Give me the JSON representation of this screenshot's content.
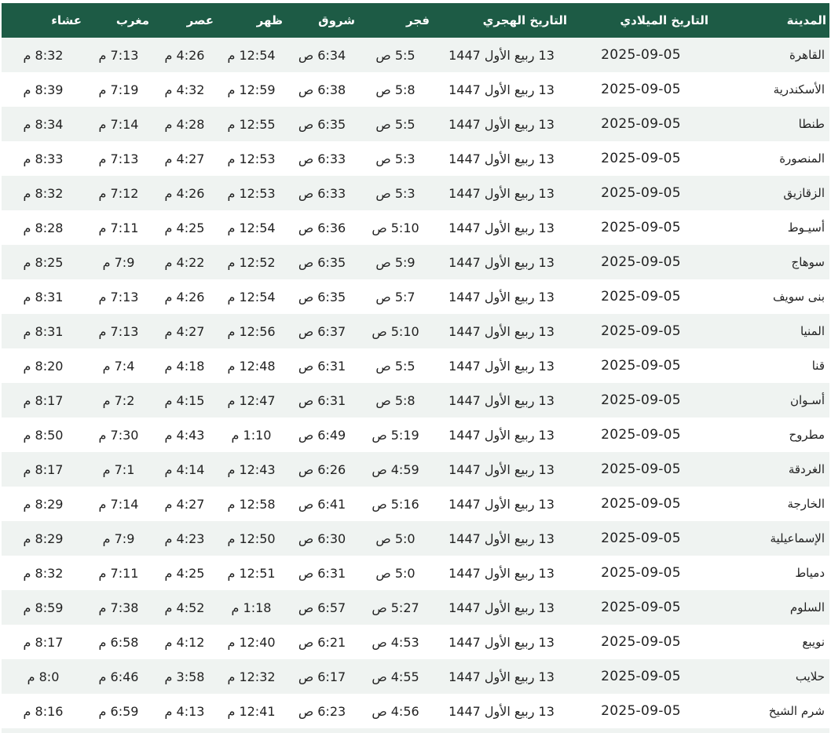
{
  "headers": [
    "المدينة",
    "التاريخ الميلادي",
    "التاريخ الهجري",
    "فجر",
    "شروق",
    "ظهر",
    "عصر",
    "مغرب",
    "عشاء"
  ],
  "rows": [
    [
      "القاهرة",
      "2025-09-05",
      "13 ربيع الأول 1447",
      "5:5 ص",
      "6:34 ص",
      "12:54 م",
      "4:26 م",
      "7:13 م",
      "8:32 م"
    ],
    [
      "الأسكندرية",
      "2025-09-05",
      "13 ربيع الأول 1447",
      "5:8 ص",
      "6:38 ص",
      "12:59 م",
      "4:32 م",
      "7:19 م",
      "8:39 م"
    ],
    [
      "طنطا",
      "2025-09-05",
      "13 ربيع الأول 1447",
      "5:5 ص",
      "6:35 ص",
      "12:55 م",
      "4:28 م",
      "7:14 م",
      "8:34 م"
    ],
    [
      "المنصورة",
      "2025-09-05",
      "13 ربيع الأول 1447",
      "5:3 ص",
      "6:33 ص",
      "12:53 م",
      "4:27 م",
      "7:13 م",
      "8:33 م"
    ],
    [
      "الزقازيق",
      "2025-09-05",
      "13 ربيع الأول 1447",
      "5:3 ص",
      "6:33 ص",
      "12:53 م",
      "4:26 م",
      "7:12 م",
      "8:32 م"
    ],
    [
      "أسيـوط",
      "2025-09-05",
      "13 ربيع الأول 1447",
      "5:10 ص",
      "6:36 ص",
      "12:54 م",
      "4:25 م",
      "7:11 م",
      "8:28 م"
    ],
    [
      "سوهاج",
      "2025-09-05",
      "13 ربيع الأول 1447",
      "5:9 ص",
      "6:35 ص",
      "12:52 م",
      "4:22 م",
      "7:9 م",
      "8:25 م"
    ],
    [
      "بنى سويف",
      "2025-09-05",
      "13 ربيع الأول 1447",
      "5:7 ص",
      "6:35 ص",
      "12:54 م",
      "4:26 م",
      "7:13 م",
      "8:31 م"
    ],
    [
      "المنيا",
      "2025-09-05",
      "13 ربيع الأول 1447",
      "5:10 ص",
      "6:37 ص",
      "12:56 م",
      "4:27 م",
      "7:13 م",
      "8:31 م"
    ],
    [
      "قنا",
      "2025-09-05",
      "13 ربيع الأول 1447",
      "5:5 ص",
      "6:31 ص",
      "12:48 م",
      "4:18 م",
      "7:4 م",
      "8:20 م"
    ],
    [
      "أسـوان",
      "2025-09-05",
      "13 ربيع الأول 1447",
      "5:8 ص",
      "6:31 ص",
      "12:47 م",
      "4:15 م",
      "7:2 م",
      "8:17 م"
    ],
    [
      "مطروح",
      "2025-09-05",
      "13 ربيع الأول 1447",
      "5:19 ص",
      "6:49 ص",
      "1:10 م",
      "4:43 م",
      "7:30 م",
      "8:50 م"
    ],
    [
      "الغردقة",
      "2025-09-05",
      "13 ربيع الأول 1447",
      "4:59 ص",
      "6:26 ص",
      "12:43 م",
      "4:14 م",
      "7:1 م",
      "8:17 م"
    ],
    [
      "الخارجة",
      "2025-09-05",
      "13 ربيع الأول 1447",
      "5:16 ص",
      "6:41 ص",
      "12:58 م",
      "4:27 م",
      "7:14 م",
      "8:29 م"
    ],
    [
      "الإسماعيلية",
      "2025-09-05",
      "13 ربيع الأول 1447",
      "5:0 ص",
      "6:30 ص",
      "12:50 م",
      "4:23 م",
      "7:9 م",
      "8:29 م"
    ],
    [
      "دمياط",
      "2025-09-05",
      "13 ربيع الأول 1447",
      "5:0 ص",
      "6:31 ص",
      "12:51 م",
      "4:25 م",
      "7:11 م",
      "8:32 م"
    ],
    [
      "السلوم",
      "2025-09-05",
      "13 ربيع الأول 1447",
      "5:27 ص",
      "6:57 ص",
      "1:18 م",
      "4:52 م",
      "7:38 م",
      "8:59 م"
    ],
    [
      "نويبع",
      "2025-09-05",
      "13 ربيع الأول 1447",
      "4:53 ص",
      "6:21 ص",
      "12:40 م",
      "4:12 م",
      "6:58 م",
      "8:17 م"
    ],
    [
      "حلايب",
      "2025-09-05",
      "13 ربيع الأول 1447",
      "4:55 ص",
      "6:17 ص",
      "12:32 م",
      "3:58 م",
      "6:46 م",
      "8:0 م"
    ],
    [
      "شرم الشيخ",
      "2025-09-05",
      "13 ربيع الأول 1447",
      "4:56 ص",
      "6:23 ص",
      "12:41 م",
      "4:13 م",
      "6:59 م",
      "8:16 م"
    ]
  ],
  "colors": {
    "header_bg": "#1d5b45",
    "header_text": "#ffffff",
    "row_alt_bg": "#eff3f1",
    "text": "#222222"
  }
}
